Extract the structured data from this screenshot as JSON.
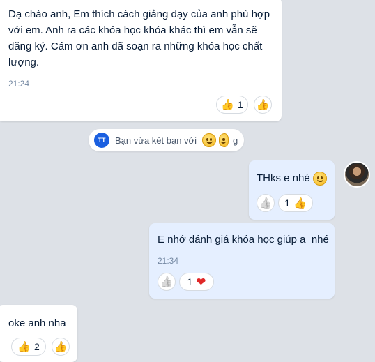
{
  "messages": [
    {
      "id": "m1",
      "text_lines": [
        "Dạ chào anh, Em thích cách giảng dạy của anh phù hợp",
        "với em. Anh ra các khóa học khóa khác thì em vẫn sẽ",
        "đăng ký. Cám ơn anh đã soạn ra những khóa học chất",
        "lượng."
      ],
      "time": "21:24",
      "reaction": {
        "emoji": "like",
        "count": "1"
      }
    },
    {
      "id": "m2",
      "text": "THks e nhé",
      "reaction": {
        "emoji": "like",
        "count": "1"
      }
    },
    {
      "id": "m3",
      "text": "E nhớ đánh giá khóa học giúp a  nhé",
      "time": "21:34",
      "reaction": {
        "emoji": "heart",
        "count": "1"
      }
    },
    {
      "id": "m4",
      "text": "oke anh nha",
      "reaction": {
        "emoji": "like",
        "count": "2"
      }
    }
  ],
  "system_notice": {
    "avatar_initials": "TT",
    "text": "Bạn vừa kết bạn với",
    "trailing_char": "g"
  },
  "glyphs": {
    "like": "👍",
    "outline_like": "👍",
    "heart": "❤"
  },
  "colors": {
    "background": "#dde1e7",
    "incoming_bubble": "#ffffff",
    "outgoing_bubble": "#e5efff",
    "timestamp": "#7589a3",
    "heart": "#e02828",
    "avatar_blue": "#1a5fe0"
  }
}
